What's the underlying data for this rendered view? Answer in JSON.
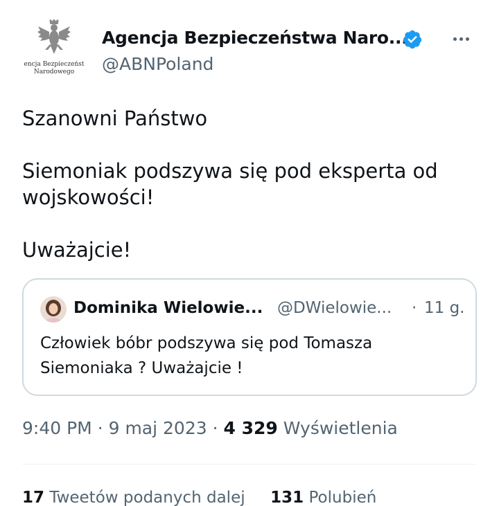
{
  "author": {
    "display_name": "Agencja Bezpieczeństwa Naro...",
    "handle": "@ABNPoland",
    "verified": true,
    "avatar_icon": "polish-eagle-emblem",
    "avatar_caption_line1": "encja Bezpieczeńst",
    "avatar_caption_line2": "Narodowego"
  },
  "more_icon": "more-horizontal-icon",
  "tweet": {
    "lines": [
      "Szanowni Państwo",
      "Siemoniak podszywa się pod eksperta od wojskowości!",
      "Uważajcie!"
    ]
  },
  "quoted_tweet": {
    "author_name": "Dominika Wielowie...",
    "handle": "@DWielowie...",
    "separator": "·",
    "time": "11 g.",
    "text": "Człowiek bóbr podszywa się pod Tomasza Siemoniaka ? Uważajcie !"
  },
  "meta": {
    "time": "9:40 PM",
    "separator": "·",
    "date": "9 maj 2023",
    "views_count": "4 329",
    "views_label": "Wyświetlenia"
  },
  "stats": {
    "retweets_count": "17",
    "retweets_label": "Tweetów podanych dalej",
    "likes_count": "131",
    "likes_label": "Polubień"
  },
  "colors": {
    "text_primary": "#0f1419",
    "text_secondary": "#536471",
    "verified_blue": "#1d9bf0",
    "border": "#cfd9de"
  }
}
